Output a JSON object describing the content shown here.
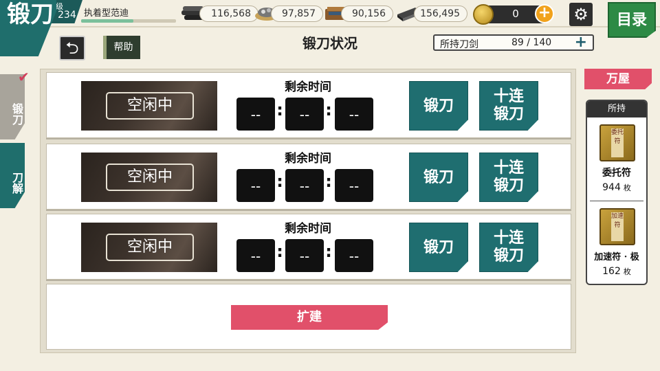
{
  "screen": {
    "title": "锻刀"
  },
  "player": {
    "level_label": "等级",
    "level": "234",
    "name": "执着型范迪",
    "xp_fraction": 0.55
  },
  "resources": [
    {
      "icon": "charcoal-icon",
      "value": "116,568"
    },
    {
      "icon": "jewel-steel-icon",
      "value": "97,857"
    },
    {
      "icon": "coolant-icon",
      "value": "90,156"
    },
    {
      "icon": "whetstone-icon",
      "value": "156,495"
    }
  ],
  "coins": {
    "value": "0",
    "add": "+"
  },
  "header": {
    "menu_label": "目录",
    "help_label": "帮助",
    "page_title": "锻刀状况",
    "gear": "⚙",
    "back": "⮌"
  },
  "owned": {
    "label": "所持刀剑",
    "value": "89 / 140",
    "add": "+"
  },
  "side_tabs": [
    {
      "label": "锻刀",
      "active": true
    },
    {
      "label": "刀解",
      "active": false
    }
  ],
  "slots": [
    {
      "status": "空闲中",
      "remain_label": "剩余时间",
      "time": [
        "--",
        "--",
        "--"
      ],
      "forge_label": "锻刀",
      "multi_line1": "十连",
      "multi_line2": "锻刀"
    },
    {
      "status": "空闲中",
      "remain_label": "剩余时间",
      "time": [
        "--",
        "--",
        "--"
      ],
      "forge_label": "锻刀",
      "multi_line1": "十连",
      "multi_line2": "锻刀"
    },
    {
      "status": "空闲中",
      "remain_label": "剩余时间",
      "time": [
        "--",
        "--",
        "--"
      ],
      "forge_label": "锻刀",
      "multi_line1": "十连",
      "multi_line2": "锻刀"
    }
  ],
  "expand": {
    "label": "扩建"
  },
  "shop": {
    "label": "万屋"
  },
  "inventory": {
    "header": "所持",
    "items": [
      {
        "name": "委托符",
        "count": "944",
        "unit": "枚",
        "talisman_text": "委托符"
      },
      {
        "name": "加速符 · 极",
        "count": "162",
        "unit": "枚",
        "talisman_text": "加速符"
      }
    ]
  },
  "colors": {
    "teal": "#1f6e70",
    "pink": "#e1506a",
    "green": "#2d8a45",
    "gold": "#f1a21b"
  }
}
